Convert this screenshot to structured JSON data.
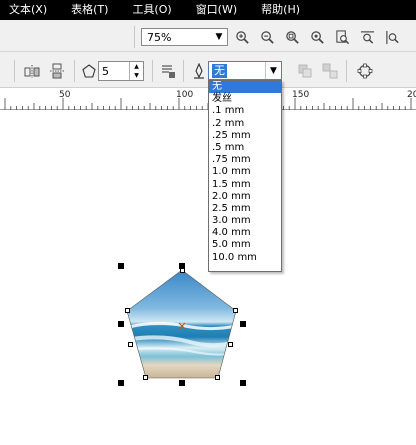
{
  "menu": {
    "items": [
      {
        "label": "文本(X)"
      },
      {
        "label": "表格(T)"
      },
      {
        "label": "工具(O)"
      },
      {
        "label": "窗口(W)"
      },
      {
        "label": "帮助(H)"
      }
    ]
  },
  "toolbar": {
    "zoom_value": "75%",
    "zoom_icons": [
      "zoom-in-icon",
      "zoom-out-icon",
      "zoom-selected-icon",
      "zoom-all-icon",
      "zoom-page-icon",
      "zoom-width-icon",
      "zoom-height-icon"
    ]
  },
  "property_bar": {
    "polygon_sides": "5",
    "outline_width_selected": "无"
  },
  "ruler": {
    "labels": [
      "50",
      "100",
      "150",
      "20"
    ]
  },
  "outline_dropdown": {
    "options": [
      "无",
      "发丝",
      ".1 mm",
      ".2 mm",
      ".25 mm",
      ".5 mm",
      ".75 mm",
      "1.0 mm",
      "1.5 mm",
      "2.0 mm",
      "2.5 mm",
      "3.0 mm",
      "4.0 mm",
      "5.0 mm",
      "10.0 mm"
    ],
    "selected_index": 0
  },
  "colors": {
    "menubar": "#000000",
    "toolbar_bg": "#f0f0f0",
    "selection": "#3178d8"
  }
}
